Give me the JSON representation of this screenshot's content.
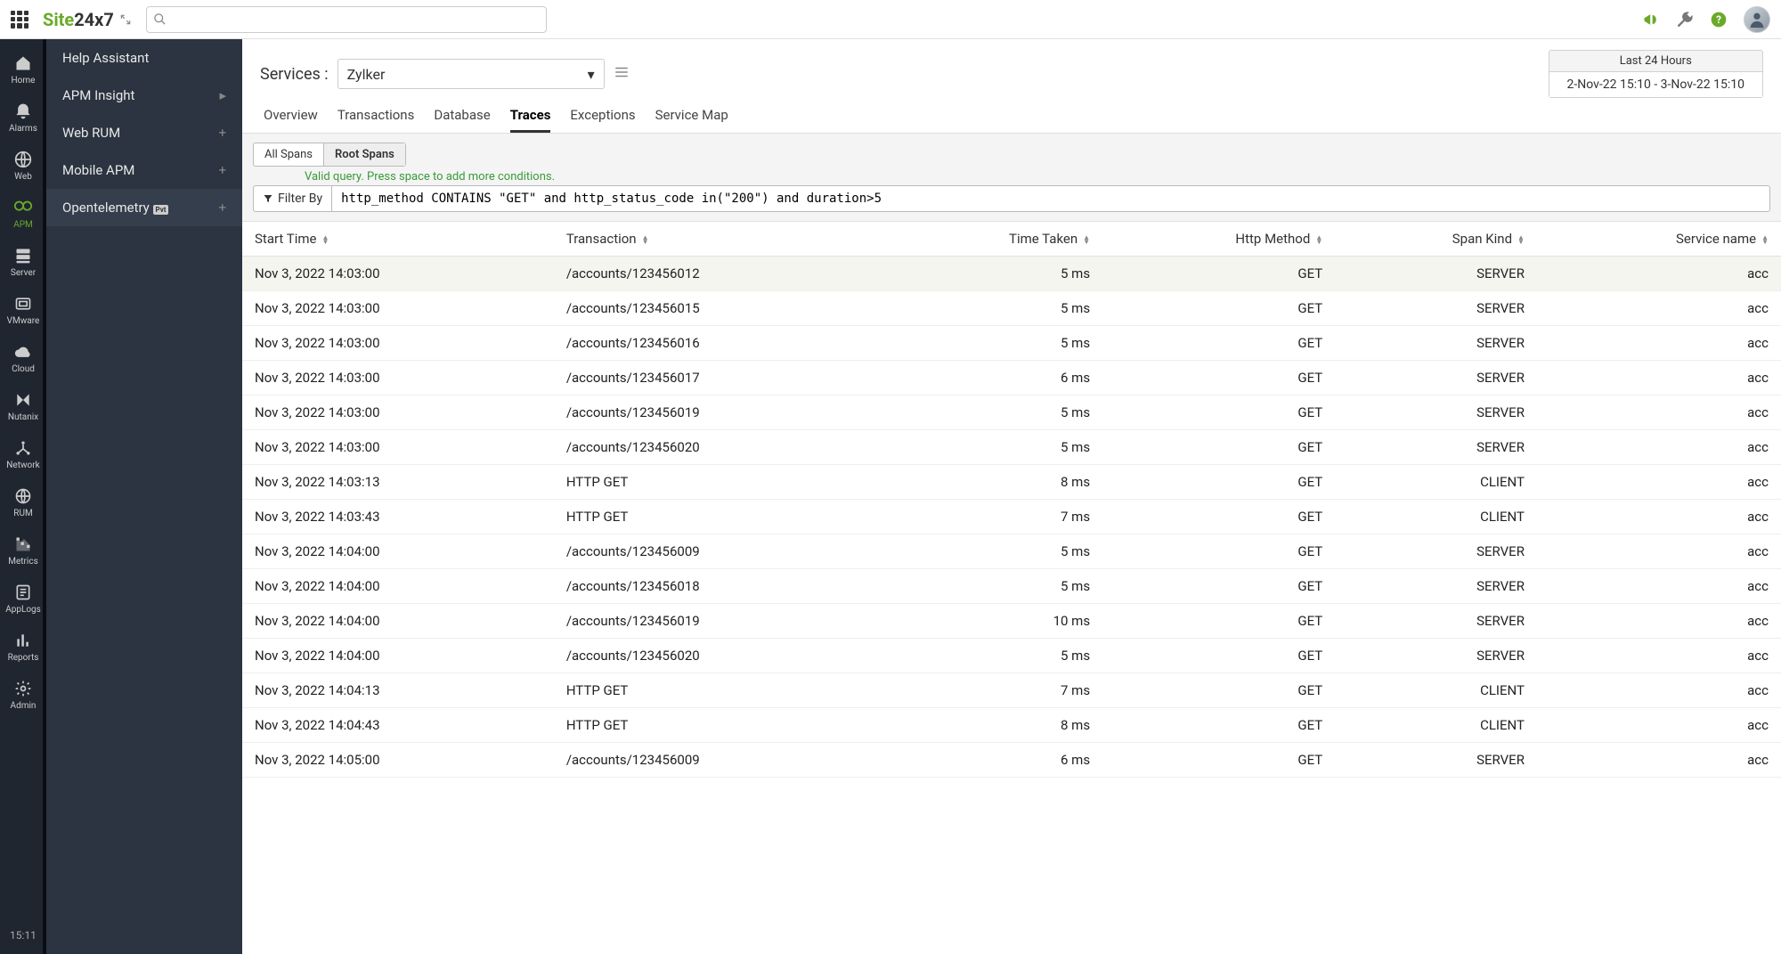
{
  "brand": {
    "part1": "Site",
    "part2": "24x7"
  },
  "search": {
    "placeholder": ""
  },
  "nav_rail": [
    {
      "id": "home",
      "label": "Home"
    },
    {
      "id": "alarms",
      "label": "Alarms"
    },
    {
      "id": "web",
      "label": "Web"
    },
    {
      "id": "apm",
      "label": "APM",
      "active": true
    },
    {
      "id": "server",
      "label": "Server"
    },
    {
      "id": "vmware",
      "label": "VMware"
    },
    {
      "id": "cloud",
      "label": "Cloud"
    },
    {
      "id": "nutanix",
      "label": "Nutanix"
    },
    {
      "id": "network",
      "label": "Network"
    },
    {
      "id": "rum",
      "label": "RUM"
    },
    {
      "id": "metrics",
      "label": "Metrics"
    },
    {
      "id": "applogs",
      "label": "AppLogs"
    },
    {
      "id": "reports",
      "label": "Reports"
    },
    {
      "id": "admin",
      "label": "Admin"
    }
  ],
  "nav_clock": "15:11",
  "sub_nav": [
    {
      "label": "Help Assistant"
    },
    {
      "label": "APM Insight",
      "chevron": true
    },
    {
      "label": "Web RUM",
      "plus": true
    },
    {
      "label": "Mobile APM",
      "plus": true
    },
    {
      "label": "Opentelemetry",
      "badge": "Pvt",
      "plus": true,
      "active": true
    }
  ],
  "services": {
    "label": "Services :",
    "selected": "Zylker"
  },
  "time_picker": {
    "label": "Last 24 Hours",
    "range": "2-Nov-22 15:10 - 3-Nov-22 15:10"
  },
  "tabs": [
    "Overview",
    "Transactions",
    "Database",
    "Traces",
    "Exceptions",
    "Service Map"
  ],
  "active_tab": "Traces",
  "span_toggle": {
    "all": "All Spans",
    "root": "Root Spans",
    "active": "root"
  },
  "filter_hint": "Valid query. Press space to add more conditions.",
  "filter_label": "Filter By",
  "filter_query": "http_method CONTAINS \"GET\" and http_status_code in(\"200\") and duration>5",
  "columns": [
    {
      "key": "start",
      "label": "Start Time",
      "align": "l"
    },
    {
      "key": "txn",
      "label": "Transaction",
      "align": "l"
    },
    {
      "key": "time",
      "label": "Time Taken",
      "align": "r"
    },
    {
      "key": "method",
      "label": "Http Method",
      "align": "r"
    },
    {
      "key": "kind",
      "label": "Span Kind",
      "align": "r"
    },
    {
      "key": "svc",
      "label": "Service name",
      "align": "r"
    }
  ],
  "rows": [
    {
      "start": "Nov 3, 2022 14:03:00",
      "txn": "/accounts/123456012",
      "time": "5 ms",
      "method": "GET",
      "kind": "SERVER",
      "svc": "acc"
    },
    {
      "start": "Nov 3, 2022 14:03:00",
      "txn": "/accounts/123456015",
      "time": "5 ms",
      "method": "GET",
      "kind": "SERVER",
      "svc": "acc"
    },
    {
      "start": "Nov 3, 2022 14:03:00",
      "txn": "/accounts/123456016",
      "time": "5 ms",
      "method": "GET",
      "kind": "SERVER",
      "svc": "acc"
    },
    {
      "start": "Nov 3, 2022 14:03:00",
      "txn": "/accounts/123456017",
      "time": "6 ms",
      "method": "GET",
      "kind": "SERVER",
      "svc": "acc"
    },
    {
      "start": "Nov 3, 2022 14:03:00",
      "txn": "/accounts/123456019",
      "time": "5 ms",
      "method": "GET",
      "kind": "SERVER",
      "svc": "acc"
    },
    {
      "start": "Nov 3, 2022 14:03:00",
      "txn": "/accounts/123456020",
      "time": "5 ms",
      "method": "GET",
      "kind": "SERVER",
      "svc": "acc"
    },
    {
      "start": "Nov 3, 2022 14:03:13",
      "txn": "HTTP GET",
      "time": "8 ms",
      "method": "GET",
      "kind": "CLIENT",
      "svc": "acc"
    },
    {
      "start": "Nov 3, 2022 14:03:43",
      "txn": "HTTP GET",
      "time": "7 ms",
      "method": "GET",
      "kind": "CLIENT",
      "svc": "acc"
    },
    {
      "start": "Nov 3, 2022 14:04:00",
      "txn": "/accounts/123456009",
      "time": "5 ms",
      "method": "GET",
      "kind": "SERVER",
      "svc": "acc"
    },
    {
      "start": "Nov 3, 2022 14:04:00",
      "txn": "/accounts/123456018",
      "time": "5 ms",
      "method": "GET",
      "kind": "SERVER",
      "svc": "acc"
    },
    {
      "start": "Nov 3, 2022 14:04:00",
      "txn": "/accounts/123456019",
      "time": "10 ms",
      "method": "GET",
      "kind": "SERVER",
      "svc": "acc"
    },
    {
      "start": "Nov 3, 2022 14:04:00",
      "txn": "/accounts/123456020",
      "time": "5 ms",
      "method": "GET",
      "kind": "SERVER",
      "svc": "acc"
    },
    {
      "start": "Nov 3, 2022 14:04:13",
      "txn": "HTTP GET",
      "time": "7 ms",
      "method": "GET",
      "kind": "CLIENT",
      "svc": "acc"
    },
    {
      "start": "Nov 3, 2022 14:04:43",
      "txn": "HTTP GET",
      "time": "8 ms",
      "method": "GET",
      "kind": "CLIENT",
      "svc": "acc"
    },
    {
      "start": "Nov 3, 2022 14:05:00",
      "txn": "/accounts/123456009",
      "time": "6 ms",
      "method": "GET",
      "kind": "SERVER",
      "svc": "acc"
    }
  ]
}
